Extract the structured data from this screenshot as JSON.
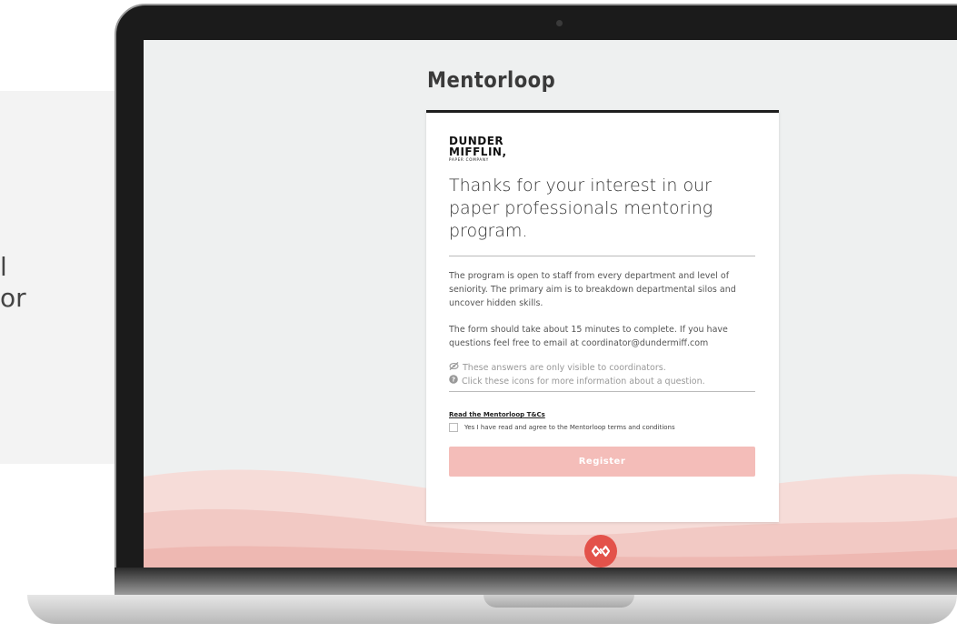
{
  "side": {
    "line1": "l",
    "line2": "or"
  },
  "app": {
    "brand": "Mentorloop"
  },
  "org": {
    "logo_line1": "DUNDER",
    "logo_line2": "MIFFLIN,",
    "logo_line3": "PAPER COMPANY"
  },
  "card": {
    "headline": "Thanks for your interest in our paper professionals mentoring program.",
    "para1": "The program is open to staff from every department and level of seniority. The primary aim is to breakdown departmental silos and uncover hidden skills.",
    "para2": "The form should take about 15 minutes to complete. If you have questions feel free to email at coordinator@dundermiff.com",
    "hint_private": "These answers are only visible to coordinators.",
    "hint_info": "Click these icons for more information about a question.",
    "tc_link": "Read the Mentorloop T&Cs",
    "agree_label": "Yes I have read and agree to the Mentorloop terms and conditions",
    "register_label": "Register"
  },
  "colors": {
    "accent": "#e3524a",
    "register_button": "#f4bdb9",
    "screen_bg": "#eef0f0"
  },
  "icons": {
    "private": "eye-slash-icon",
    "info": "question-circle-icon",
    "footer": "mentorloop-infinity-icon"
  }
}
